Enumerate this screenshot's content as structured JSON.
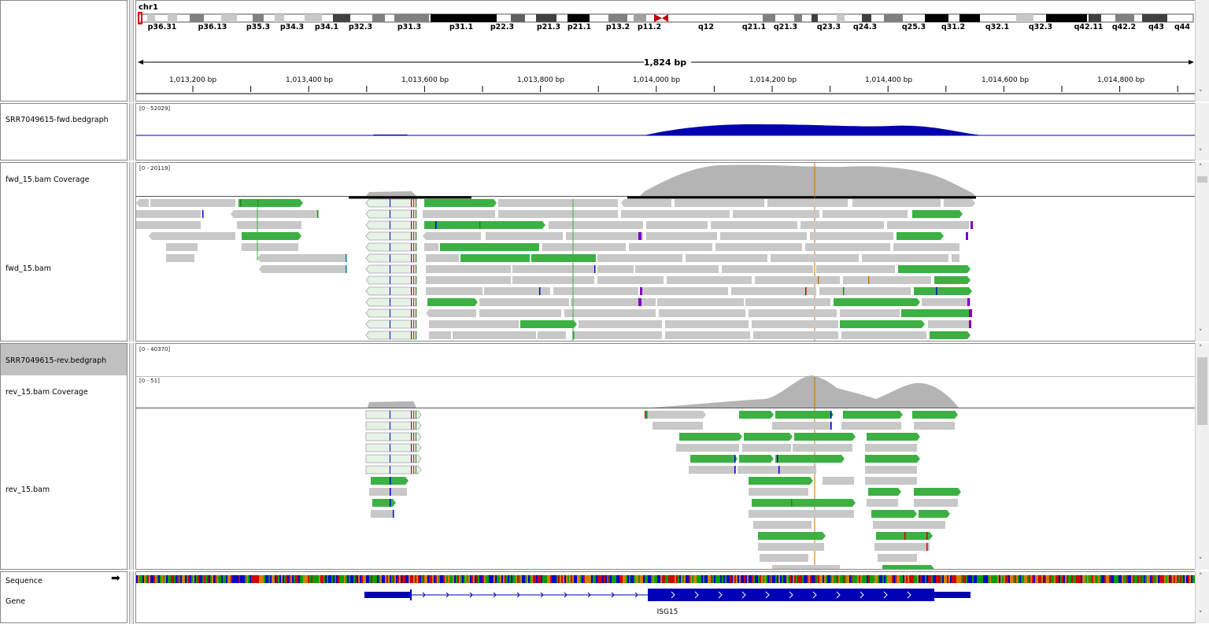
{
  "header": {
    "chromosome": "chr1",
    "span_label": "1,824 bp",
    "cytobands": [
      "p36.31",
      "p36.13",
      "p35.3",
      "p34.3",
      "p34.1",
      "p32.3",
      "p31.3",
      "p31.1",
      "p22.3",
      "p21.3",
      "p21.1",
      "p13.2",
      "p11.2",
      "q12",
      "q21.1",
      "q21.3",
      "q23.3",
      "q24.3",
      "q25.3",
      "q31.2",
      "q32.1",
      "q32.3",
      "q42.11",
      "q42.2",
      "q43",
      "q44"
    ],
    "ruler_ticks": [
      "1,013,200 bp",
      "1,013,400 bp",
      "1,013,600 bp",
      "1,013,800 bp",
      "1,014,000 bp",
      "1,014,200 bp",
      "1,014,400 bp",
      "1,014,600 bp",
      "1,014,800 bp"
    ]
  },
  "tracks": {
    "fwd_bedgraph": {
      "name": "SRR7049615-fwd.bedgraph",
      "range": "[0 - 52029]"
    },
    "fwd_coverage": {
      "name": "fwd_15.bam Coverage",
      "range": "[0 - 20119]"
    },
    "fwd_bam": {
      "name": "fwd_15.bam"
    },
    "rev_bedgraph": {
      "name": "SRR7049615-rev.bedgraph",
      "range": "[0 - 40370]"
    },
    "rev_coverage": {
      "name": "rev_15.bam Coverage",
      "range": "[0 - 51]"
    },
    "rev_bam": {
      "name": "rev_15.bam"
    },
    "sequence": {
      "name": "Sequence",
      "arrow": "➡"
    },
    "gene": {
      "name": "Gene",
      "gene_label": "ISG15"
    }
  },
  "colors": {
    "bedgraph": "#0000b0",
    "coverage": "#b4b4b4",
    "read": "#c8c8c8",
    "read_highlight": "#3cb043",
    "gene": "#0000b4",
    "selected_track_bg": "#c0c0c0"
  },
  "icons": {
    "sequence_strand": "right-arrow-icon",
    "scroll_up": "chevron-up-icon",
    "scroll_down": "chevron-down-icon"
  }
}
